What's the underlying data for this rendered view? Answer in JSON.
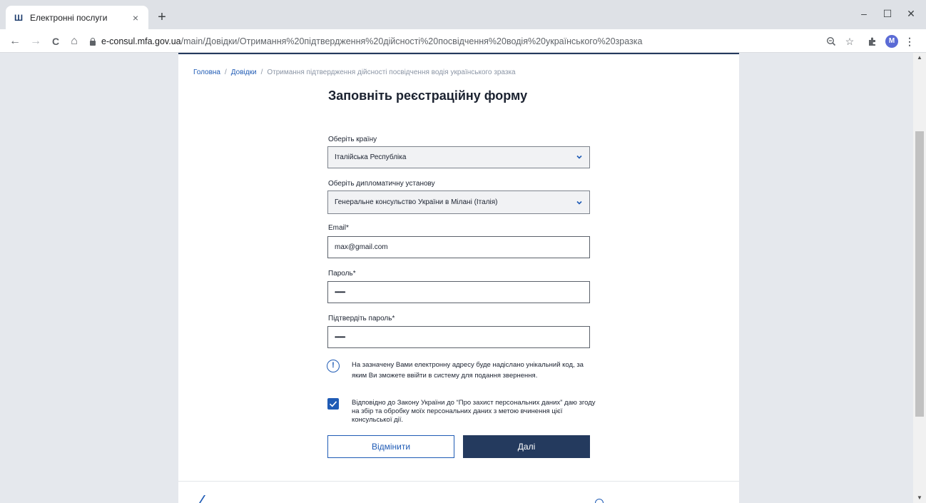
{
  "browser": {
    "tab_title": "Електронні послуги",
    "tab_close": "×",
    "new_tab": "+",
    "window_controls": {
      "minimize": "–",
      "maximize": "☐",
      "close": "✕"
    },
    "nav": {
      "back": "←",
      "forward": "→",
      "reload": "C",
      "home": "⌂"
    },
    "url_host": "e-consul.mfa.gov.ua",
    "url_path": "/main/Довідки/Отримання%20підтвердження%20дійсності%20посвідчення%20водія%20українського%20зразка",
    "profile_initial": "M",
    "toolbar_icons": [
      "zoom-icon",
      "star-icon",
      "extensions-icon",
      "menu-icon"
    ]
  },
  "breadcrumb": {
    "home": "Головна",
    "sep1": "/",
    "section": "Довідки",
    "sep2": "/",
    "current": "Отримання підтвердження дійсності посвідчення водія українського зразка"
  },
  "form": {
    "title": "Заповніть реєстраційну форму",
    "country_label": "Оберіть країну",
    "country_value": "Італійська Республіка",
    "mission_label": "Оберіть дипломатичну установу",
    "mission_value": "Генеральне консульство України в Мілані (Італія)",
    "email_label": "Email*",
    "email_value": "max@gmail.com",
    "password_label": "Пароль*",
    "password_value": "••••••••",
    "confirm_label": "Підтвердіть пароль*",
    "confirm_value": "••••••••",
    "notice_icon": "!",
    "notice": "На зазначену Вами електронну адресу буде надіслано унікальний код, за яким Ви зможете ввійти в систему для подання звернення.",
    "consent_checked": true,
    "consent": "Відповідно до Закону України до “Про захист персональних даних” даю згоду на збір та обробку моїх персональних даних з метою вчинення цієї консульської дії.",
    "cancel_label": "Відмінити",
    "next_label": "Далі"
  },
  "colors": {
    "primary": "#243a5e",
    "link": "#1f5bb5",
    "page_bg": "#e5e8ed"
  }
}
